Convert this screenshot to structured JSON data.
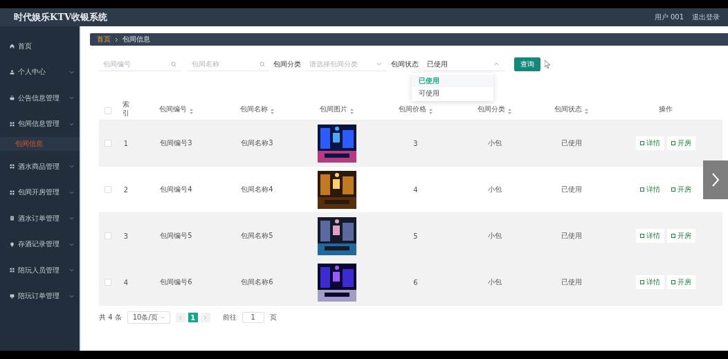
{
  "header": {
    "title": "时代娱乐KTV收银系统",
    "user": "用户 001",
    "logout": "退出登录"
  },
  "sidebar": {
    "items": [
      {
        "label": "首页",
        "kind": "link",
        "selected": false
      },
      {
        "label": "个人中心",
        "kind": "menu",
        "selected": false
      },
      {
        "label": "公告信息管理",
        "kind": "menu",
        "selected": false
      },
      {
        "label": "包间信息管理",
        "kind": "menu",
        "selected": false,
        "children": [
          {
            "label": "包间信息",
            "selected": true
          }
        ]
      },
      {
        "label": "酒水商品管理",
        "kind": "menu",
        "selected": false
      },
      {
        "label": "包间开房管理",
        "kind": "menu",
        "selected": false
      },
      {
        "label": "酒水订单管理",
        "kind": "menu",
        "selected": false
      },
      {
        "label": "存酒记录管理",
        "kind": "menu",
        "selected": false
      },
      {
        "label": "陪玩人员管理",
        "kind": "menu",
        "selected": false
      },
      {
        "label": "陪玩订单管理",
        "kind": "menu",
        "selected": false
      }
    ]
  },
  "breadcrumb": [
    "首页",
    "包间信息"
  ],
  "filters": {
    "room_number": {
      "placeholder": "包间编号"
    },
    "room_name": {
      "placeholder": "包间名称"
    },
    "category": {
      "label": "包间分类",
      "placeholder": "请选择包间分类"
    },
    "status": {
      "label": "包间状态",
      "value": "已使用",
      "expanded": true,
      "options": [
        {
          "label": "已使用",
          "selected": true
        },
        {
          "label": "可使用",
          "selected": false
        }
      ]
    },
    "search_button": "查询"
  },
  "table": {
    "all_checked": false,
    "columns": [
      "索引",
      "包间编号",
      "包间名称",
      "包间图片",
      "包间价格",
      "包间分类",
      "包间状态",
      "操作"
    ],
    "rows": [
      {
        "index": "1",
        "number": "包间编号3",
        "name": "包间名称3",
        "price": "3",
        "category": "小包",
        "status": "已使用",
        "shaded": true,
        "checked": false,
        "actions": [
          "详情",
          "开房"
        ]
      },
      {
        "index": "2",
        "number": "包间编号4",
        "name": "包间名称4",
        "price": "4",
        "category": "小包",
        "status": "已使用",
        "shaded": false,
        "checked": false,
        "actions": [
          "详情",
          "开房"
        ]
      },
      {
        "index": "3",
        "number": "包间编号5",
        "name": "包间名称5",
        "price": "5",
        "category": "小包",
        "status": "已使用",
        "shaded": true,
        "checked": false,
        "actions": [
          "详情",
          "开房"
        ]
      },
      {
        "index": "4",
        "number": "包间编号6",
        "name": "包间名称6",
        "price": "6",
        "category": "小包",
        "status": "已使用",
        "shaded": true,
        "checked": false,
        "actions": [
          "详情",
          "开房"
        ]
      }
    ]
  },
  "pagination": {
    "total": "共 4 条",
    "page_size": "10条/页",
    "pages": [
      {
        "label": "1",
        "selected": true
      }
    ],
    "goto_label": "前往",
    "goto_value": "1",
    "goto_suffix": "页"
  }
}
